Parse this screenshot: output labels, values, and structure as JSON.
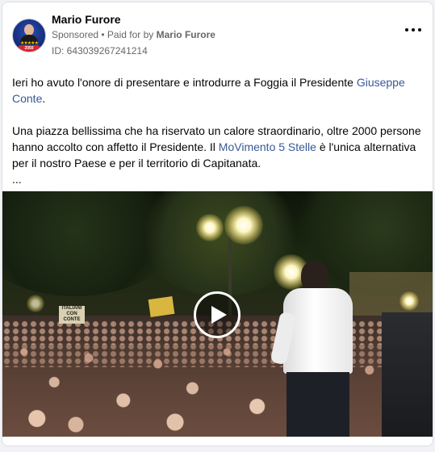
{
  "post": {
    "author": "Mario Furore",
    "sponsored_label": "Sponsored",
    "separator": " • ",
    "paid_for_prefix": "Paid for by ",
    "paid_for_name": "Mario Furore",
    "id_line": "ID: 643039267241214",
    "more_icon": "more-horizontal-icon",
    "avatar_year": "2050",
    "avatar_stars": "★★★★★"
  },
  "body": {
    "p1_text": "Ieri ho avuto l'onore di presentare e introdurre a Foggia il Presidente ",
    "p1_link": "Giuseppe Conte",
    "p1_end": ".",
    "p2_text": "Una piazza bellissima che ha riservato un calore straordinario, oltre 2000 persone hanno accolto con affetto il Presidente. Il ",
    "p2_link": "MoVimento 5 Stelle",
    "p2_end": " è l'unica alternativa per il nostro Paese e per il territorio di Capitanata.",
    "ellipsis": "..."
  },
  "video": {
    "play_icon": "play-icon",
    "sign_left": "ITALIANI CON CONTE",
    "colors": {
      "link": "#385898",
      "muted": "#65676b",
      "text": "#050505"
    }
  }
}
